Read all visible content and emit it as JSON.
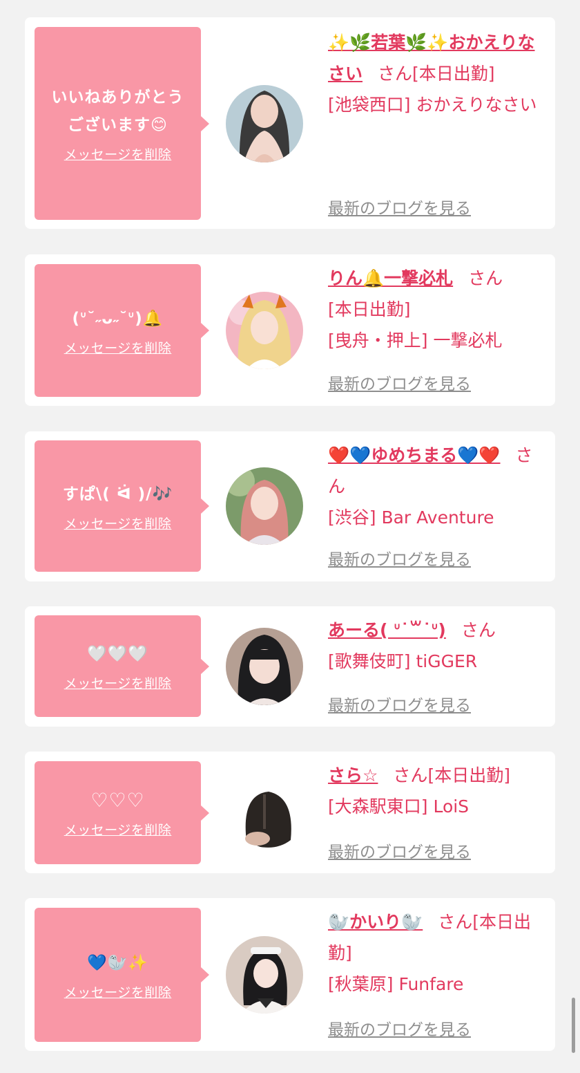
{
  "theme": {
    "accent": "#e2395e",
    "bubble": "#f997a6",
    "background": "#f2f2f2",
    "link_gray": "#8e8e8e"
  },
  "labels": {
    "delete": "メッセージを削除",
    "latest_blog": "最新のブログを見る",
    "san": "さん"
  },
  "entries": [
    {
      "message": "いいねありがとう ございます😊",
      "name": "✨🌿若葉🌿✨おかえりなさい",
      "status": "[本日出勤]",
      "shop": "[池袋西口] おかえりなさい",
      "avatar_icon": "avatar-photo"
    },
    {
      "message": "(ᐡ˘˶ᴗ˶˘ᐡ)🔔",
      "name": "りん🔔一撃必札",
      "status": "[本日出勤]",
      "shop": "[曳舟・押上] 一撃必札",
      "avatar_icon": "avatar-photo"
    },
    {
      "message": "すぱ\\( ᐛ )/🎶",
      "name": "❤️💙ゆめちまる💙❤️",
      "status": "",
      "shop": "[渋谷] Bar Aventure",
      "avatar_icon": "avatar-photo"
    },
    {
      "message": "🤍🤍🤍",
      "name": "あーる( ᐡ˙꒳˙ᐡ)",
      "status": "",
      "shop": "[歌舞伎町] tiGGER",
      "avatar_icon": "avatar-photo"
    },
    {
      "message": "♡♡♡",
      "name": "さら☆",
      "status": "[本日出勤]",
      "shop": "[大森駅東口] LoiS",
      "avatar_icon": "avatar-photo"
    },
    {
      "message": "💙🦭✨",
      "name": "🦭かいり🦭",
      "status": "[本日出勤]",
      "shop": "[秋葉原] Funfare",
      "avatar_icon": "avatar-photo"
    }
  ]
}
